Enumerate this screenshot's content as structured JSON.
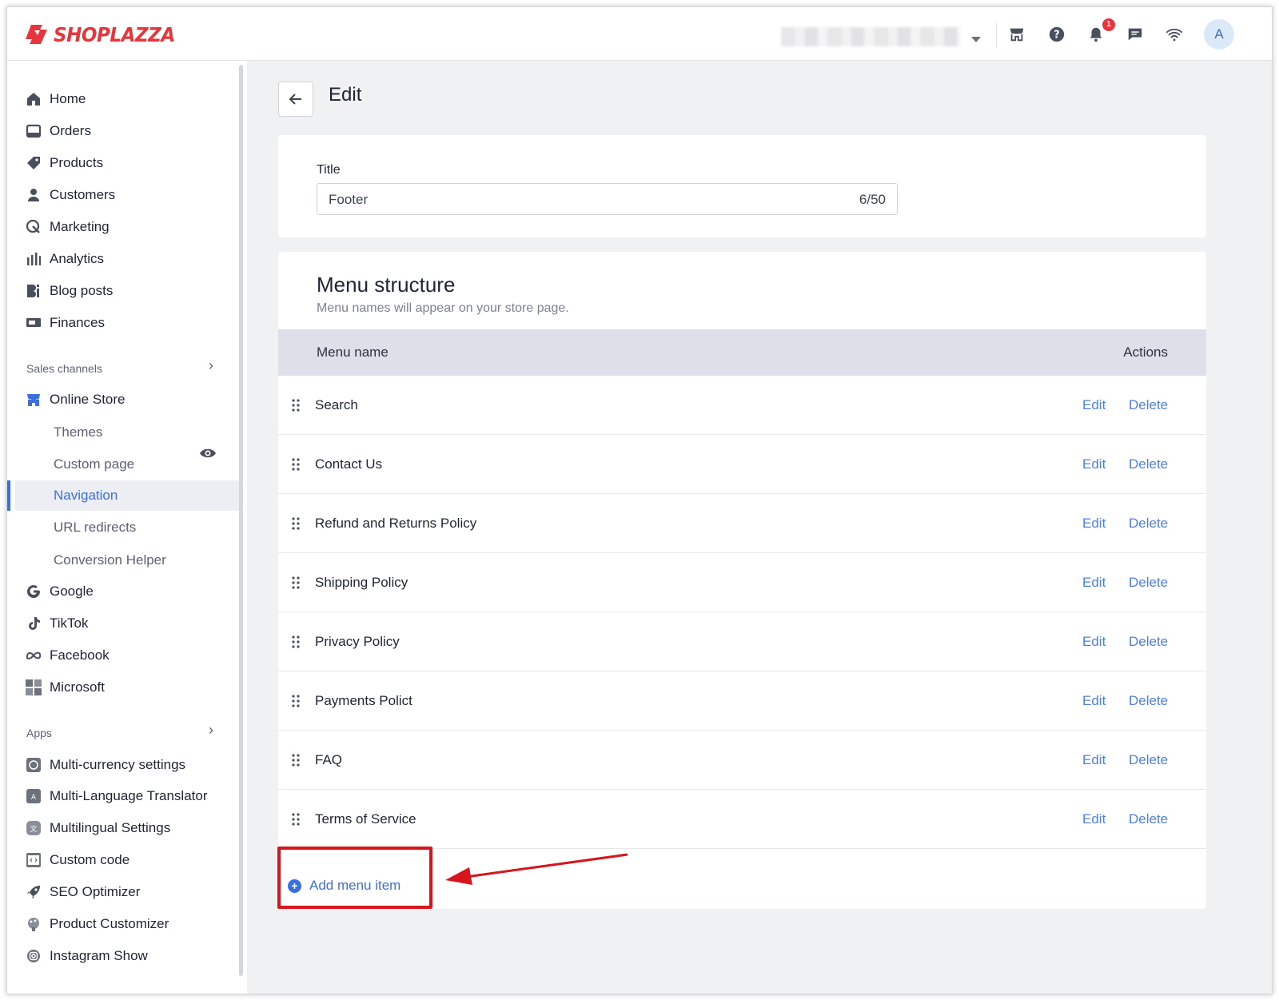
{
  "brand": {
    "name": "SHOPLAZZA",
    "color": "#e8343c"
  },
  "topbar": {
    "icons": [
      "store-icon",
      "help-icon",
      "bell-icon",
      "chat-icon",
      "wifi-icon"
    ],
    "notification_count": "1",
    "avatar_initial": "A"
  },
  "sidebar": {
    "main_items": [
      {
        "label": "Home",
        "icon": "home-icon"
      },
      {
        "label": "Orders",
        "icon": "orders-icon"
      },
      {
        "label": "Products",
        "icon": "tag-icon"
      },
      {
        "label": "Customers",
        "icon": "person-icon"
      },
      {
        "label": "Marketing",
        "icon": "marketing-icon"
      },
      {
        "label": "Analytics",
        "icon": "bar-chart-icon"
      },
      {
        "label": "Blog posts",
        "icon": "blog-icon"
      },
      {
        "label": "Finances",
        "icon": "finance-icon"
      }
    ],
    "sales_channels_header": "Sales channels",
    "online_store": "Online Store",
    "online_store_sub": [
      {
        "label": "Themes"
      },
      {
        "label": "Custom page"
      },
      {
        "label": "Navigation",
        "active": true
      },
      {
        "label": "URL redirects"
      },
      {
        "label": "Conversion Helper"
      }
    ],
    "channels": [
      {
        "label": "Google",
        "icon": "google-icon"
      },
      {
        "label": "TikTok",
        "icon": "tiktok-icon"
      },
      {
        "label": "Facebook",
        "icon": "meta-icon"
      },
      {
        "label": "Microsoft",
        "icon": "microsoft-icon"
      }
    ],
    "apps_header": "Apps",
    "apps": [
      {
        "label": "Multi-currency settings",
        "icon": "currency-app-icon"
      },
      {
        "label": "Multi-Language Translator",
        "icon": "translator-app-icon"
      },
      {
        "label": "Multilingual Settings",
        "icon": "multilingual-app-icon"
      },
      {
        "label": "Custom code",
        "icon": "code-app-icon"
      },
      {
        "label": "SEO Optimizer",
        "icon": "rocket-icon"
      },
      {
        "label": "Product Customizer",
        "icon": "customizer-icon"
      },
      {
        "label": "Instagram Show",
        "icon": "instagram-icon"
      }
    ]
  },
  "page": {
    "title": "Edit",
    "title_card": {
      "label": "Title",
      "value": "Footer",
      "counter": "6/50"
    },
    "menu_card": {
      "heading": "Menu structure",
      "subheading": "Menu names will appear on your store page.",
      "col_name": "Menu name",
      "col_actions": "Actions",
      "rows": [
        {
          "name": "Search",
          "edit": "Edit",
          "delete": "Delete"
        },
        {
          "name": "Contact Us",
          "edit": "Edit",
          "delete": "Delete"
        },
        {
          "name": "Refund and Returns Policy",
          "edit": "Edit",
          "delete": "Delete"
        },
        {
          "name": "Shipping Policy",
          "edit": "Edit",
          "delete": "Delete"
        },
        {
          "name": "Privacy Policy",
          "edit": "Edit",
          "delete": "Delete"
        },
        {
          "name": "Payments Polict",
          "edit": "Edit",
          "delete": "Delete"
        },
        {
          "name": "FAQ",
          "edit": "Edit",
          "delete": "Delete"
        },
        {
          "name": "Terms of Service",
          "edit": "Edit",
          "delete": "Delete"
        }
      ],
      "add_label": "Add menu item"
    }
  },
  "colors": {
    "accent": "#3b6fe0",
    "link": "#4d7fe6",
    "annotation": "#d6151c",
    "table_header": "#dde0e8"
  }
}
